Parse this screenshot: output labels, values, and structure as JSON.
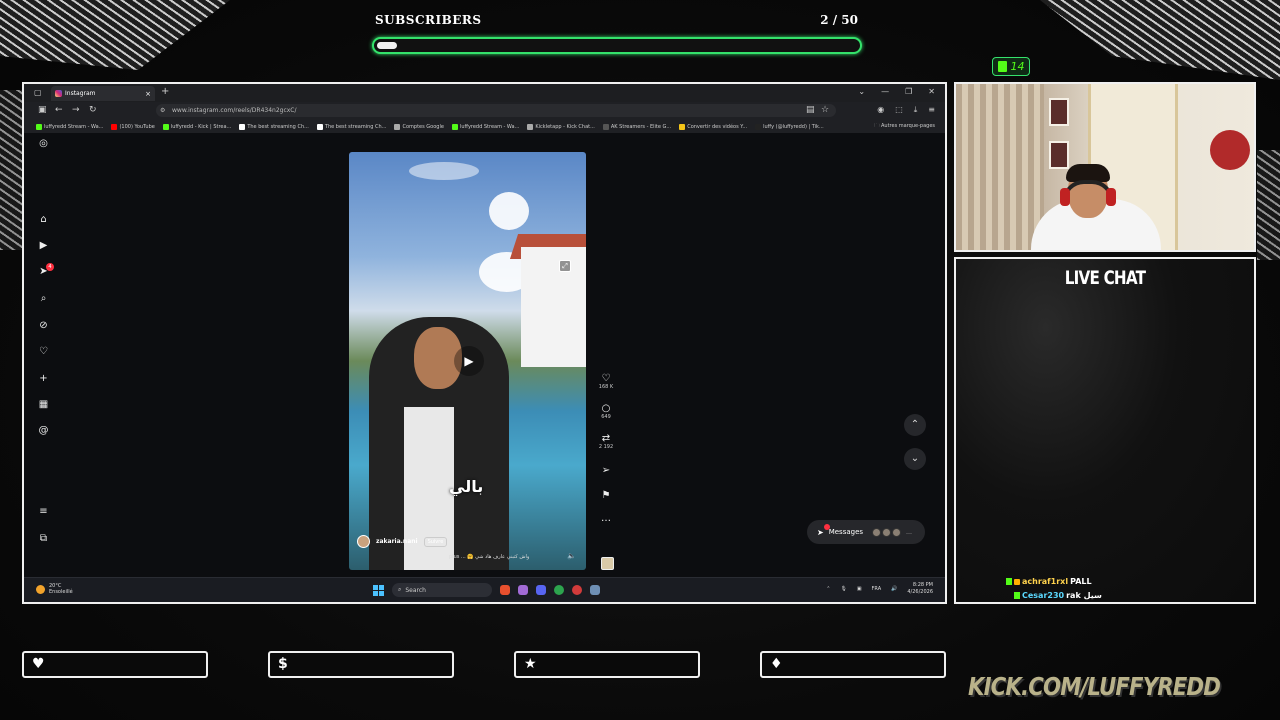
{
  "subscribers": {
    "label": "SUBSCRIBERS",
    "count_text": "2 / 50",
    "progress": 0.04
  },
  "kick_badge": {
    "value": "14"
  },
  "browser": {
    "tab_title": "Instagram",
    "url": "www.instagram.com/reels/DR434n2gcxC/",
    "bookmarks": [
      "luffyredd Stream - Wa...",
      "(100) YouTube",
      "luffyredd - Kick | Strea...",
      "The best streaming Ch...",
      "The best streaming Ch...",
      "Comptes Google",
      "luffyredd Stream - Wa...",
      "Kickletapp - Kick Chat...",
      "AK Streamers - Elite G...",
      "Convertir des vidéos Y...",
      "luffy (@luffyredd) | Tik..."
    ],
    "other_bookmarks": "Autres marque-pages"
  },
  "instagram": {
    "notification_badge": "4",
    "reel": {
      "caption_overlay": "بالي",
      "author": "zakaria.nani",
      "follow_label": "Suivre",
      "caption": "plus ... 🤗 واش كتبني عارف هاد شي"
    },
    "actions": {
      "likes": "168 K",
      "comments": "649",
      "reposts": "2 192"
    },
    "messages_label": "Messages",
    "messages_badge": "4"
  },
  "taskbar": {
    "weather_temp": "20°C",
    "weather_desc": "Ensoleillé",
    "search_placeholder": "Search",
    "language": "FRA",
    "time": "8:28 PM",
    "date": "4/26/2026"
  },
  "chat": {
    "title": "LIVE CHAT",
    "messages": [
      {
        "user": "achraf1rxl",
        "text": "PALL"
      },
      {
        "user": "Cesar230",
        "text": "rak سيل"
      }
    ]
  },
  "widgets": [
    {
      "icon": "♥",
      "name": "heart"
    },
    {
      "icon": "$",
      "name": "dollar"
    },
    {
      "icon": "★",
      "name": "star"
    },
    {
      "icon": "♦",
      "name": "drop"
    }
  ],
  "brand": "KICK.COM/LUFFYREDD",
  "colors": {
    "accent": "#34e26b",
    "kick_green": "#53fc18",
    "frame": "#f0f0f0"
  }
}
